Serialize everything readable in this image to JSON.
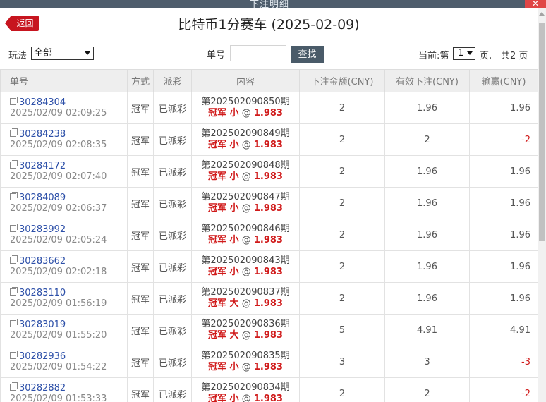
{
  "window": {
    "strip_title": "下注明细",
    "close_label": "✕"
  },
  "header": {
    "back_label": "返回",
    "title": "比特币1分赛车 (2025-02-09)"
  },
  "filters": {
    "play_label": "玩法",
    "play_value": "全部",
    "order_label": "单号",
    "order_value": "",
    "search_label": "查找",
    "page_prefix": "当前:第",
    "page_value": "1",
    "page_suffix": "页,",
    "total_pages": "共2 页"
  },
  "table": {
    "columns": [
      "单号",
      "方式",
      "派彩",
      "内容",
      "下注金额(CNY)",
      "有效下注(CNY)",
      "输赢(CNY)"
    ],
    "rows": [
      {
        "id": "30284304",
        "time": "2025/02/09 02:09:25",
        "mode": "冠军",
        "status": "已派彩",
        "period": "第202502090850期",
        "pick": "冠军 小",
        "at": "@",
        "odds": "1.983",
        "amount": "2",
        "valid": "1.96",
        "win": "1.96"
      },
      {
        "id": "30284238",
        "time": "2025/02/09 02:08:35",
        "mode": "冠军",
        "status": "已派彩",
        "period": "第202502090849期",
        "pick": "冠军 小",
        "at": "@",
        "odds": "1.983",
        "amount": "2",
        "valid": "2",
        "win": "-2"
      },
      {
        "id": "30284172",
        "time": "2025/02/09 02:07:40",
        "mode": "冠军",
        "status": "已派彩",
        "period": "第202502090848期",
        "pick": "冠军 小",
        "at": "@",
        "odds": "1.983",
        "amount": "2",
        "valid": "1.96",
        "win": "1.96"
      },
      {
        "id": "30284089",
        "time": "2025/02/09 02:06:37",
        "mode": "冠军",
        "status": "已派彩",
        "period": "第202502090847期",
        "pick": "冠军 小",
        "at": "@",
        "odds": "1.983",
        "amount": "2",
        "valid": "1.96",
        "win": "1.96"
      },
      {
        "id": "30283992",
        "time": "2025/02/09 02:05:24",
        "mode": "冠军",
        "status": "已派彩",
        "period": "第202502090846期",
        "pick": "冠军 小",
        "at": "@",
        "odds": "1.983",
        "amount": "2",
        "valid": "1.96",
        "win": "1.96"
      },
      {
        "id": "30283662",
        "time": "2025/02/09 02:02:18",
        "mode": "冠军",
        "status": "已派彩",
        "period": "第202502090843期",
        "pick": "冠军 小",
        "at": "@",
        "odds": "1.983",
        "amount": "2",
        "valid": "1.96",
        "win": "1.96"
      },
      {
        "id": "30283110",
        "time": "2025/02/09 01:56:19",
        "mode": "冠军",
        "status": "已派彩",
        "period": "第202502090837期",
        "pick": "冠军 大",
        "at": "@",
        "odds": "1.983",
        "amount": "2",
        "valid": "1.96",
        "win": "1.96"
      },
      {
        "id": "30283019",
        "time": "2025/02/09 01:55:20",
        "mode": "冠军",
        "status": "已派彩",
        "period": "第202502090836期",
        "pick": "冠军 大",
        "at": "@",
        "odds": "1.983",
        "amount": "5",
        "valid": "4.91",
        "win": "4.91"
      },
      {
        "id": "30282936",
        "time": "2025/02/09 01:54:22",
        "mode": "冠军",
        "status": "已派彩",
        "period": "第202502090835期",
        "pick": "冠军 小",
        "at": "@",
        "odds": "1.983",
        "amount": "3",
        "valid": "3",
        "win": "-3"
      },
      {
        "id": "30282882",
        "time": "2025/02/09 01:53:33",
        "mode": "冠军",
        "status": "已派彩",
        "period": "第202502090834期",
        "pick": "冠军 小",
        "at": "@",
        "odds": "1.983",
        "amount": "2",
        "valid": "2",
        "win": "-2"
      }
    ]
  },
  "colors": {
    "accent_red": "#c7151f",
    "loss_red": "#d01a1a",
    "link_blue": "#2c4fa8",
    "button_slate": "#4a5b69"
  },
  "icons": {
    "row_icon": "copy-doc-icon",
    "back_icon": "back-arrow-icon"
  }
}
